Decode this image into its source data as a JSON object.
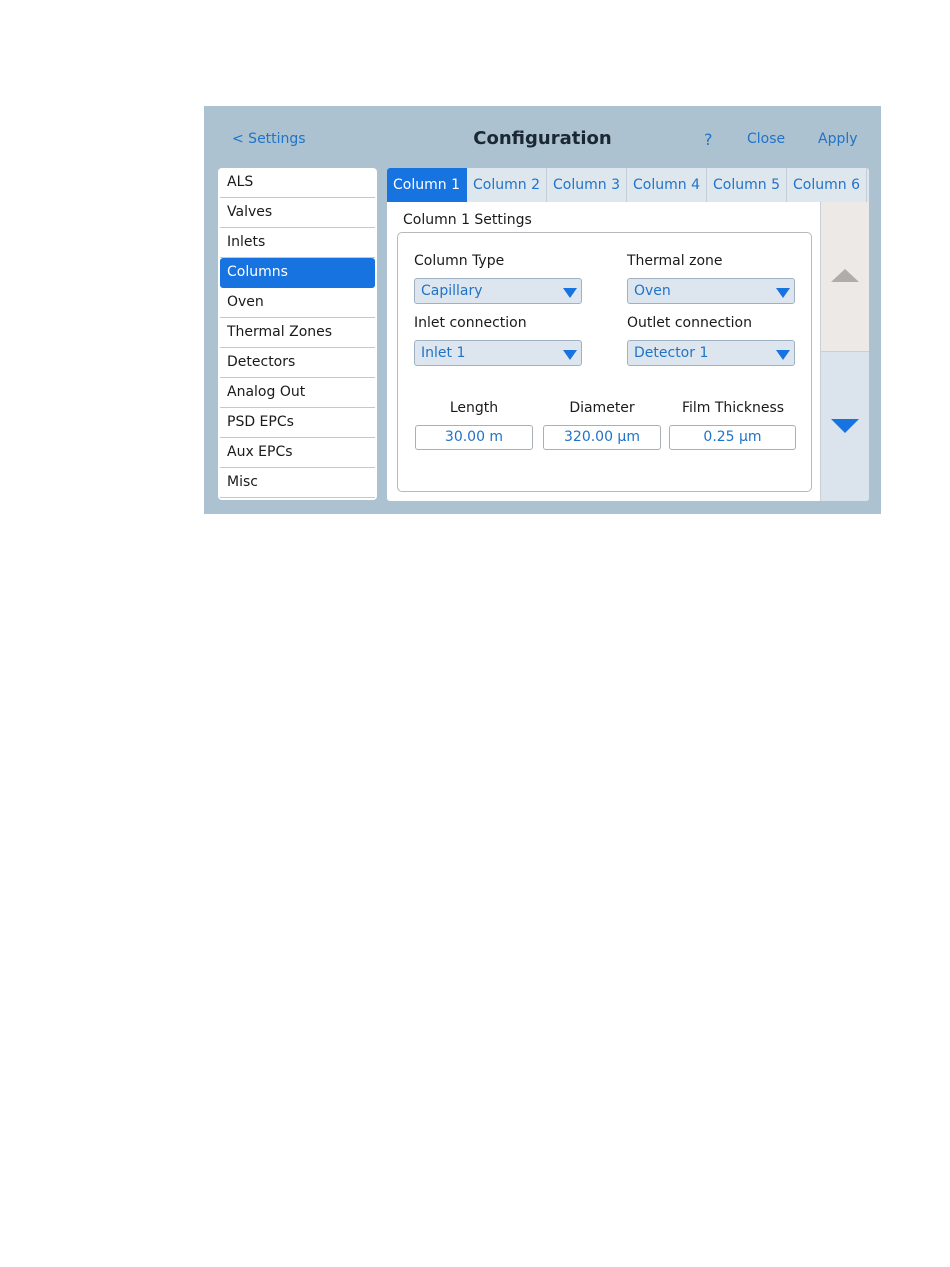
{
  "header": {
    "back_label": "< Settings",
    "title": "Configuration",
    "help_label": "?",
    "close_label": "Close",
    "apply_label": "Apply"
  },
  "sidebar": {
    "items": [
      {
        "label": "ALS"
      },
      {
        "label": "Valves"
      },
      {
        "label": "Inlets"
      },
      {
        "label": "Columns",
        "selected": true
      },
      {
        "label": "Oven"
      },
      {
        "label": "Thermal Zones"
      },
      {
        "label": "Detectors"
      },
      {
        "label": "Analog Out"
      },
      {
        "label": "PSD EPCs"
      },
      {
        "label": "Aux EPCs"
      },
      {
        "label": "Misc"
      }
    ]
  },
  "tabs": [
    {
      "label": "Column 1",
      "selected": true
    },
    {
      "label": "Column 2"
    },
    {
      "label": "Column 3"
    },
    {
      "label": "Column 4"
    },
    {
      "label": "Column 5"
    },
    {
      "label": "Column 6"
    }
  ],
  "settings": {
    "section_title": "Column 1 Settings",
    "column_type": {
      "label": "Column Type",
      "value": "Capillary"
    },
    "thermal_zone": {
      "label": "Thermal zone",
      "value": "Oven"
    },
    "inlet_connection": {
      "label": "Inlet connection",
      "value": "Inlet 1"
    },
    "outlet_connection": {
      "label": "Outlet connection",
      "value": "Detector 1"
    },
    "length": {
      "label": "Length",
      "value": "30.00 m"
    },
    "diameter": {
      "label": "Diameter",
      "value": "320.00 µm"
    },
    "film_thickness": {
      "label": "Film Thickness",
      "value": "0.25 µm"
    }
  },
  "icons": {
    "scroll_up": "arrow-up-icon",
    "scroll_down": "arrow-down-icon",
    "dropdown": "chevron-down-icon"
  },
  "colors": {
    "accent": "#1673e0",
    "link": "#1f73c8",
    "frame": "#adc2d0",
    "scroll_up_disabled": "#b0aca8"
  }
}
